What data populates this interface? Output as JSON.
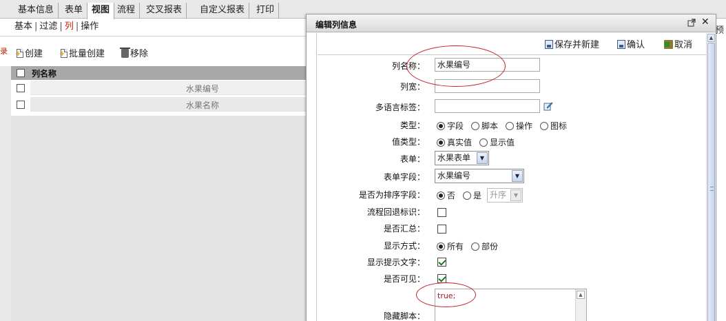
{
  "tabs": [
    {
      "label": "基本信息",
      "active": false
    },
    {
      "label": "表单",
      "active": false
    },
    {
      "label": "视图",
      "active": true
    },
    {
      "label": "流程",
      "active": false
    },
    {
      "label": "交叉报表",
      "active": false
    },
    {
      "label": "自定义报表",
      "active": false
    },
    {
      "label": "打印",
      "active": false
    }
  ],
  "subnav": {
    "items": [
      "基本",
      "过滤",
      "列",
      "操作"
    ],
    "current": "列",
    "separator": "|"
  },
  "side_mark": "录",
  "toolbar": {
    "create_label": "创建",
    "batch_create_label": "批量创建",
    "remove_label": "移除"
  },
  "grid": {
    "header": "列名称",
    "rows": [
      "水果编号",
      "水果名称"
    ]
  },
  "right_cut_text": "预",
  "dialog": {
    "title": "编辑列信息",
    "save_new_label": "保存并新建",
    "confirm_label": "确认",
    "cancel_label": "取消",
    "fields": {
      "col_name": {
        "label": "列名称：",
        "value": "水果编号"
      },
      "col_width": {
        "label": "列宽：",
        "value": ""
      },
      "i18n": {
        "label": "多语言标签：",
        "value": ""
      },
      "type": {
        "label": "类型：",
        "options": [
          "字段",
          "脚本",
          "操作",
          "图标"
        ],
        "selected": "字段"
      },
      "value_type": {
        "label": "值类型：",
        "options": [
          "真实值",
          "显示值"
        ],
        "selected": "真实值"
      },
      "form": {
        "label": "表单：",
        "value": "水果表单"
      },
      "form_field": {
        "label": "表单字段：",
        "value": "水果编号"
      },
      "sort_field": {
        "label": "是否为排序字段：",
        "options": [
          "否",
          "是"
        ],
        "selected": "否",
        "order_value": "升序"
      },
      "flow_back": {
        "label": "流程回退标识：",
        "checked": false
      },
      "summary": {
        "label": "是否汇总：",
        "checked": false
      },
      "display_mode": {
        "label": "显示方式：",
        "options": [
          "所有",
          "部份"
        ],
        "selected": "所有"
      },
      "show_tip": {
        "label": "显示提示文字：",
        "checked": true
      },
      "visible": {
        "label": "是否可见：",
        "checked": true
      },
      "hide_script": {
        "label": "隐藏脚本：",
        "value": "true;"
      }
    }
  },
  "colors": {
    "annotation": "#c4202a",
    "current_subnav": "#cc2200",
    "check_mark": "#1a7a1a"
  }
}
